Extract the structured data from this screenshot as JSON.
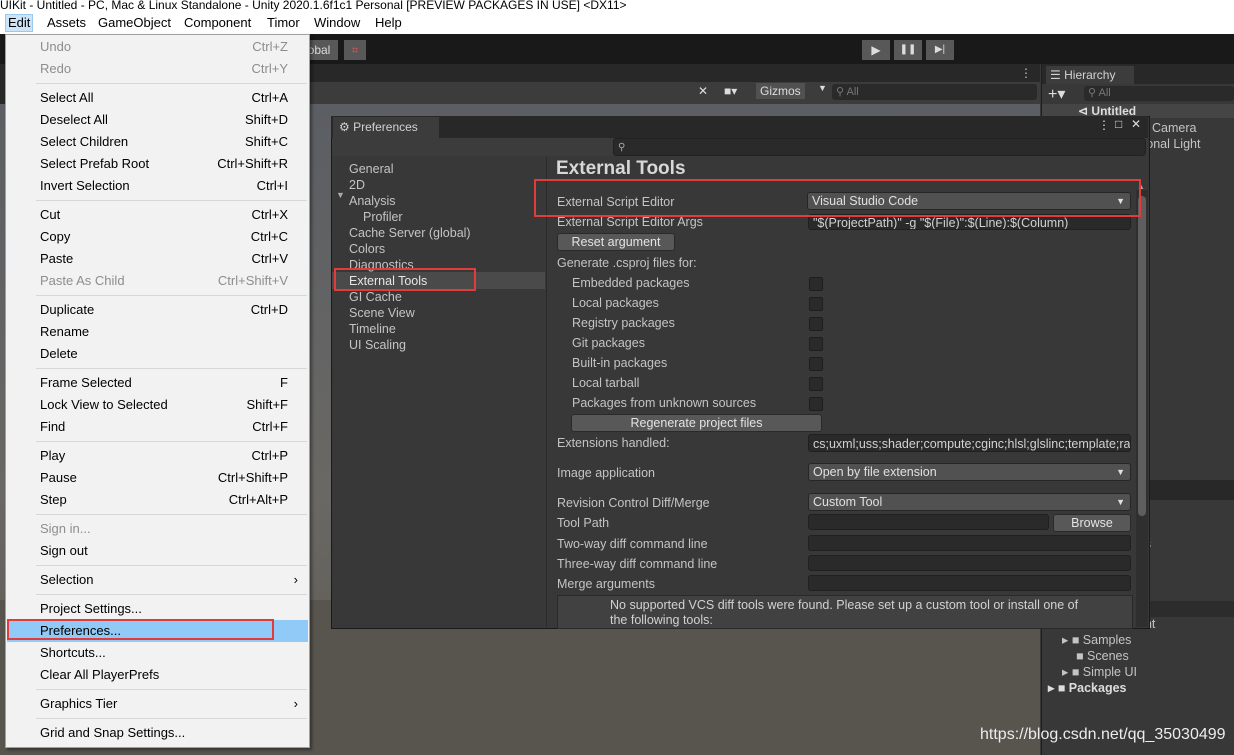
{
  "window_title": "UIKit - Untitled - PC, Mac & Linux Standalone - Unity 2020.1.6f1c1 Personal [PREVIEW PACKAGES IN USE] <DX11>",
  "menubar": [
    "Edit",
    "Assets",
    "GameObject",
    "Component",
    "Timor",
    "Window",
    "Help"
  ],
  "toolbar": {
    "global_label": "obal",
    "play": "▶",
    "pause": "❚❚",
    "step": "▶|"
  },
  "scene_toolbar": {
    "gizmos": "Gizmos",
    "search_placeholder": "All"
  },
  "edit_menu": [
    {
      "label": "Undo",
      "shortcut": "Ctrl+Z",
      "disabled": true
    },
    {
      "label": "Redo",
      "shortcut": "Ctrl+Y",
      "disabled": true
    },
    {
      "label": "Select All",
      "shortcut": "Ctrl+A"
    },
    {
      "label": "Deselect All",
      "shortcut": "Shift+D"
    },
    {
      "label": "Select Children",
      "shortcut": "Shift+C"
    },
    {
      "label": "Select Prefab Root",
      "shortcut": "Ctrl+Shift+R"
    },
    {
      "label": "Invert Selection",
      "shortcut": "Ctrl+I"
    },
    {
      "label": "Cut",
      "shortcut": "Ctrl+X"
    },
    {
      "label": "Copy",
      "shortcut": "Ctrl+C"
    },
    {
      "label": "Paste",
      "shortcut": "Ctrl+V"
    },
    {
      "label": "Paste As Child",
      "shortcut": "Ctrl+Shift+V",
      "disabled": true
    },
    {
      "label": "Duplicate",
      "shortcut": "Ctrl+D"
    },
    {
      "label": "Rename",
      "shortcut": ""
    },
    {
      "label": "Delete",
      "shortcut": ""
    },
    {
      "label": "Frame Selected",
      "shortcut": "F"
    },
    {
      "label": "Lock View to Selected",
      "shortcut": "Shift+F"
    },
    {
      "label": "Find",
      "shortcut": "Ctrl+F"
    },
    {
      "label": "Play",
      "shortcut": "Ctrl+P"
    },
    {
      "label": "Pause",
      "shortcut": "Ctrl+Shift+P"
    },
    {
      "label": "Step",
      "shortcut": "Ctrl+Alt+P"
    },
    {
      "label": "Sign in...",
      "shortcut": "",
      "disabled": true
    },
    {
      "label": "Sign out",
      "shortcut": ""
    },
    {
      "label": "Selection",
      "shortcut": "",
      "submenu": true
    },
    {
      "label": "Project Settings...",
      "shortcut": ""
    },
    {
      "label": "Preferences...",
      "shortcut": "",
      "highlighted": true
    },
    {
      "label": "Shortcuts...",
      "shortcut": ""
    },
    {
      "label": "Clear All PlayerPrefs",
      "shortcut": ""
    },
    {
      "label": "Graphics Tier",
      "shortcut": "",
      "submenu": true
    },
    {
      "label": "Grid and Snap Settings...",
      "shortcut": ""
    }
  ],
  "submenu_arrow": "›",
  "preferences": {
    "tab_title": "Preferences",
    "categories": [
      "General",
      "2D",
      "Analysis",
      "Profiler",
      "Cache Server (global)",
      "Colors",
      "Diagnostics",
      "External Tools",
      "GI Cache",
      "Scene View",
      "Timeline",
      "UI Scaling"
    ],
    "selected_category": "External Tools",
    "section_title": "External Tools",
    "external_script_editor_label": "External Script Editor",
    "external_script_editor_value": "Visual Studio Code",
    "editor_args_label": "External Script Editor Args",
    "editor_args_value": "\"$(ProjectPath)\" -g \"$(File)\":$(Line):$(Column)",
    "reset_argument": "Reset argument",
    "csproj_label": "Generate .csproj files for:",
    "csproj_options": [
      "Embedded packages",
      "Local packages",
      "Registry packages",
      "Git packages",
      "Built-in packages",
      "Local tarball",
      "Packages from unknown sources"
    ],
    "regenerate": "Regenerate project files",
    "extensions_label": "Extensions handled:",
    "extensions_value": "cs;uxml;uss;shader;compute;cginc;hlsl;glslinc;template;ra",
    "image_app_label": "Image application",
    "image_app_value": "Open by file extension",
    "revision_label": "Revision Control Diff/Merge",
    "revision_value": "Custom Tool",
    "tool_path_label": "Tool Path",
    "browse": "Browse",
    "two_way_label": "Two-way diff command line",
    "three_way_label": "Three-way diff command line",
    "merge_label": "Merge arguments",
    "vcs_message": "No supported VCS diff tools were found. Please set up a custom tool or install one of the following tools:"
  },
  "hierarchy": {
    "title": "Hierarchy",
    "search_placeholder": "All",
    "scene": "Untitled",
    "items": [
      "Camera",
      "tional Light"
    ],
    "project_items": [
      "Samples",
      "Scenes",
      "Simple UI",
      "Packages"
    ],
    "partial_labels": [
      "ls",
      "s",
      "ent"
    ]
  },
  "watermark": "https://blog.csdn.net/qq_35030499"
}
